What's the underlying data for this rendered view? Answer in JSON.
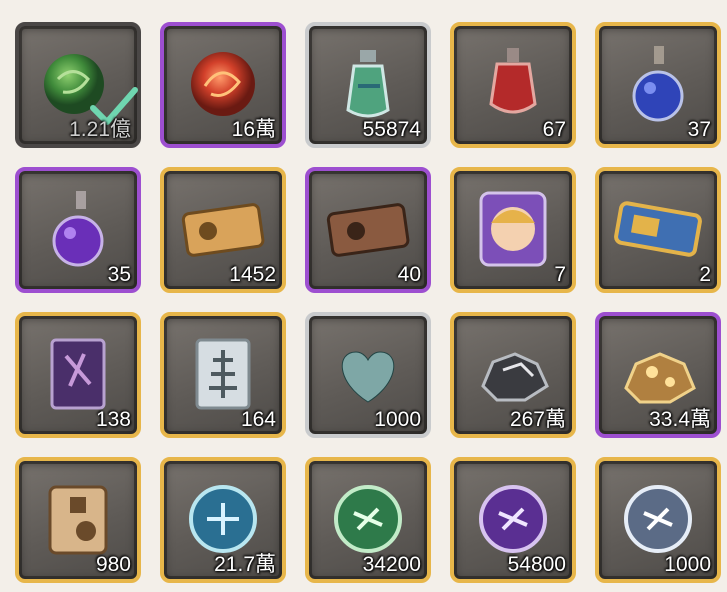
{
  "inventory": {
    "items": [
      {
        "id": "orb-green",
        "icon": "green-swirl-orb-icon",
        "quantity": "1.21億",
        "rarity": "dark",
        "selected": true
      },
      {
        "id": "orb-fire",
        "icon": "fire-orb-icon",
        "quantity": "16萬",
        "rarity": "purple"
      },
      {
        "id": "potion-green",
        "icon": "green-potion-icon",
        "quantity": "55874",
        "rarity": "silver"
      },
      {
        "id": "potion-red",
        "icon": "red-potion-icon",
        "quantity": "67",
        "rarity": "gold"
      },
      {
        "id": "potion-blue",
        "icon": "blue-potion-icon",
        "quantity": "37",
        "rarity": "gold"
      },
      {
        "id": "potion-purple",
        "icon": "purple-potion-icon",
        "quantity": "35",
        "rarity": "purple"
      },
      {
        "id": "ticket-gold",
        "icon": "gold-ticket-icon",
        "quantity": "1452",
        "rarity": "gold"
      },
      {
        "id": "ticket-bronze",
        "icon": "bronze-ticket-icon",
        "quantity": "40",
        "rarity": "purple"
      },
      {
        "id": "portrait-card",
        "icon": "character-portrait-icon",
        "quantity": "7",
        "rarity": "gold"
      },
      {
        "id": "blue-ticket",
        "icon": "blue-gold-ticket-icon",
        "quantity": "2",
        "rarity": "gold"
      },
      {
        "id": "scroll-purple",
        "icon": "purple-scroll-icon",
        "quantity": "138",
        "rarity": "gold"
      },
      {
        "id": "scroll-silver",
        "icon": "silver-scroll-icon",
        "quantity": "164",
        "rarity": "gold"
      },
      {
        "id": "heart",
        "icon": "heart-icon",
        "quantity": "1000",
        "rarity": "silver"
      },
      {
        "id": "ore-dark",
        "icon": "dark-ore-icon",
        "quantity": "267萬",
        "rarity": "gold"
      },
      {
        "id": "ore-gold",
        "icon": "gold-ore-icon",
        "quantity": "33.4萬",
        "rarity": "purple"
      },
      {
        "id": "rune-tablet",
        "icon": "rune-tablet-icon",
        "quantity": "980",
        "rarity": "gold"
      },
      {
        "id": "coin-blue",
        "icon": "blue-rune-coin-icon",
        "quantity": "21.7萬",
        "rarity": "gold"
      },
      {
        "id": "coin-green",
        "icon": "green-rune-coin-icon",
        "quantity": "34200",
        "rarity": "gold"
      },
      {
        "id": "coin-purple",
        "icon": "purple-rune-coin-icon",
        "quantity": "54800",
        "rarity": "gold"
      },
      {
        "id": "coin-silver",
        "icon": "silver-rune-coin-icon",
        "quantity": "1000",
        "rarity": "gold"
      }
    ]
  }
}
